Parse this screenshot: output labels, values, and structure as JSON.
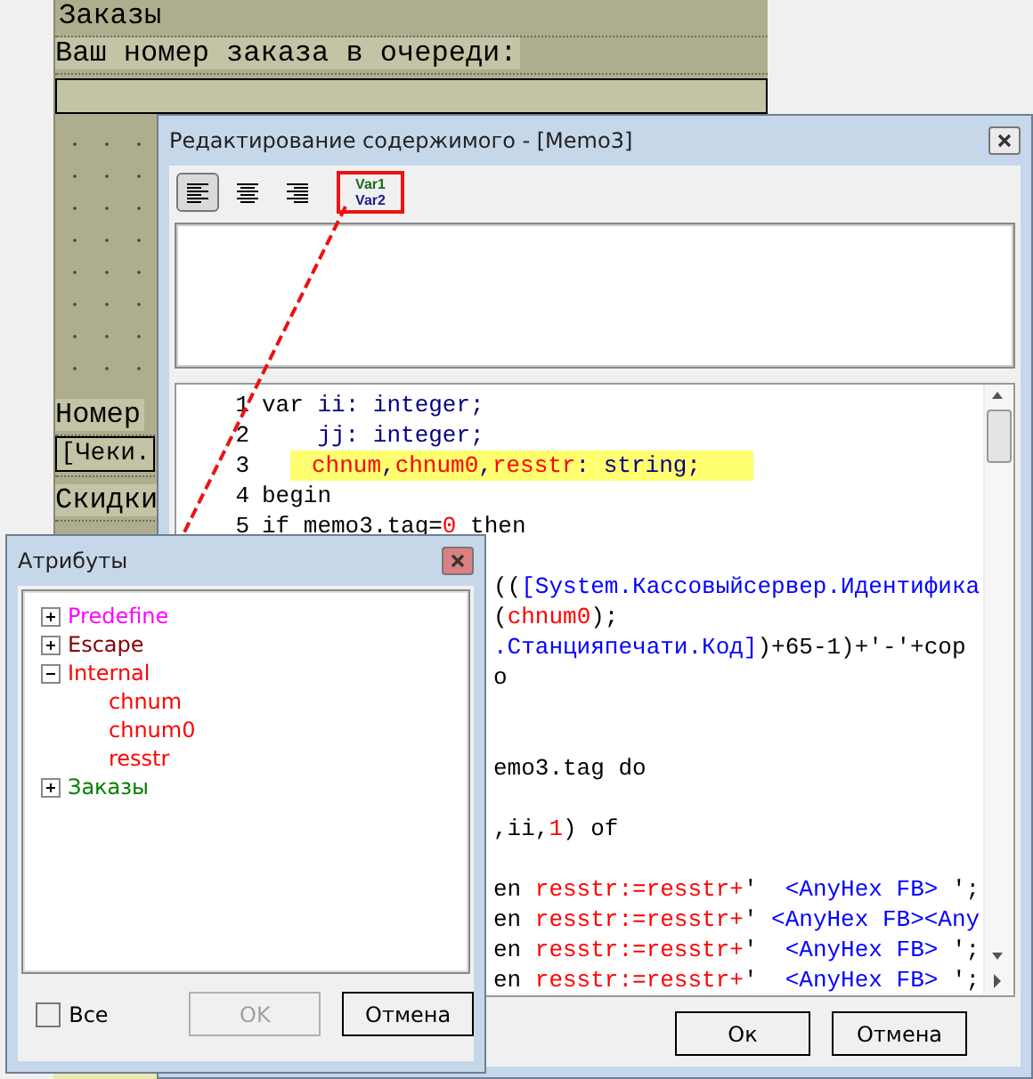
{
  "report": {
    "bands": [
      {
        "kind": "title",
        "text": "Заказы"
      },
      {
        "kind": "label",
        "text": "Ваш номер заказа в очереди:"
      },
      {
        "kind": "field"
      },
      {
        "kind": "grid"
      },
      {
        "kind": "label",
        "text": "Номер"
      },
      {
        "kind": "boxed",
        "text": "[Чеки."
      },
      {
        "kind": "gap"
      },
      {
        "kind": "label",
        "text": "Скидки"
      }
    ]
  },
  "editor": {
    "title": "Редактирование содержимого - [Memo3]",
    "toolbar": [
      {
        "kind": "align-left",
        "selected": true
      },
      {
        "kind": "align-center",
        "selected": false
      },
      {
        "kind": "align-right",
        "selected": false
      },
      {
        "kind": "vars",
        "lines": [
          "Var1",
          "Var2"
        ],
        "marked": true
      }
    ],
    "code": [
      {
        "kind": "full",
        "number": "1",
        "segments": [
          {
            "kind": "kw",
            "text": "var "
          },
          {
            "kind": "ident",
            "text": "ii: integer;"
          }
        ]
      },
      {
        "kind": "full",
        "number": "2",
        "segments": [
          {
            "kind": "ident",
            "text": "    jj: integer;"
          }
        ]
      },
      {
        "kind": "full",
        "number": "3",
        "highlighted": true,
        "segments": [
          {
            "kind": "var",
            "text": "chnum"
          },
          {
            "kind": "ident",
            "text": ","
          },
          {
            "kind": "var",
            "text": "chnum0"
          },
          {
            "kind": "ident",
            "text": ","
          },
          {
            "kind": "var",
            "text": "resstr"
          },
          {
            "kind": "ident",
            "text": ": string;"
          }
        ]
      },
      {
        "kind": "full",
        "number": "4",
        "segments": [
          {
            "kind": "kw",
            "text": "begin"
          }
        ]
      },
      {
        "kind": "full",
        "number": "5",
        "segments": [
          {
            "kind": "kw",
            "text": "if memo3.tag="
          },
          {
            "kind": "num",
            "text": "0"
          },
          {
            "kind": "kw",
            "text": " then"
          }
        ]
      },
      {
        "kind": "blank"
      },
      {
        "kind": "clipped",
        "segments": [
          {
            "kind": "kw",
            "text": "(("
          },
          {
            "kind": "str",
            "text": "[System.Кассовыйсервер.Идентифика"
          }
        ]
      },
      {
        "kind": "clipped",
        "segments": [
          {
            "kind": "kw",
            "text": "("
          },
          {
            "kind": "var",
            "text": "chnum0"
          },
          {
            "kind": "kw",
            "text": ");"
          }
        ]
      },
      {
        "kind": "clipped",
        "segments": [
          {
            "kind": "str",
            "text": ".Станцияпечати.Код]"
          },
          {
            "kind": "kw",
            "text": ")+65-1)+'-'+cop"
          }
        ]
      },
      {
        "kind": "clipped",
        "segments": [
          {
            "kind": "kw",
            "text": "o"
          }
        ]
      },
      {
        "kind": "blank"
      },
      {
        "kind": "blank"
      },
      {
        "kind": "clipped",
        "segments": [
          {
            "kind": "kw",
            "text": "emo3.tag do"
          }
        ]
      },
      {
        "kind": "blank"
      },
      {
        "kind": "clipped",
        "segments": [
          {
            "kind": "kw",
            "text": ",ii,"
          },
          {
            "kind": "num",
            "text": "1"
          },
          {
            "kind": "kw",
            "text": ") of"
          }
        ]
      },
      {
        "kind": "blank"
      },
      {
        "kind": "clipped",
        "segments": [
          {
            "kind": "kw",
            "text": "en "
          },
          {
            "kind": "var",
            "text": "resstr:=resstr+"
          },
          {
            "kind": "kw",
            "text": "'"
          },
          {
            "kind": "str",
            "text": "  <AnyHex FB> "
          },
          {
            "kind": "kw",
            "text": "';"
          }
        ]
      },
      {
        "kind": "clipped",
        "segments": [
          {
            "kind": "kw",
            "text": "en "
          },
          {
            "kind": "var",
            "text": "resstr:=resstr+"
          },
          {
            "kind": "kw",
            "text": "'"
          },
          {
            "kind": "str",
            "text": " <AnyHex FB><Any"
          }
        ]
      },
      {
        "kind": "clipped",
        "segments": [
          {
            "kind": "kw",
            "text": "en "
          },
          {
            "kind": "var",
            "text": "resstr:=resstr+"
          },
          {
            "kind": "kw",
            "text": "'"
          },
          {
            "kind": "str",
            "text": "  <AnyHex FB> "
          },
          {
            "kind": "kw",
            "text": "';"
          }
        ]
      },
      {
        "kind": "clipped",
        "segments": [
          {
            "kind": "kw",
            "text": "en "
          },
          {
            "kind": "var",
            "text": "resstr:=resstr+"
          },
          {
            "kind": "kw",
            "text": "'"
          },
          {
            "kind": "str",
            "text": "  <AnyHex FB> "
          },
          {
            "kind": "kw",
            "text": "';"
          }
        ]
      }
    ],
    "buttons": [
      "Ок",
      "Отмена"
    ]
  },
  "attributes": {
    "title": "Атрибуты",
    "tree": [
      {
        "label": "Predefine",
        "color": "#ff00ff",
        "expanded": false
      },
      {
        "label": "Escape",
        "color": "#800000",
        "expanded": false
      },
      {
        "label": "Internal",
        "color": "#ff0000",
        "expanded": true,
        "children": [
          {
            "label": "chnum",
            "color": "#ff0000"
          },
          {
            "label": "chnum0",
            "color": "#ff0000"
          },
          {
            "label": "resstr",
            "color": "#ff0000"
          }
        ]
      },
      {
        "label": "Заказы",
        "color": "#008000",
        "expanded": false
      }
    ],
    "all": {
      "label": "Все",
      "checked": false
    },
    "buttons": [
      {
        "label": "OK",
        "disabled": true
      },
      {
        "label": "Отмена",
        "disabled": false
      }
    ]
  }
}
